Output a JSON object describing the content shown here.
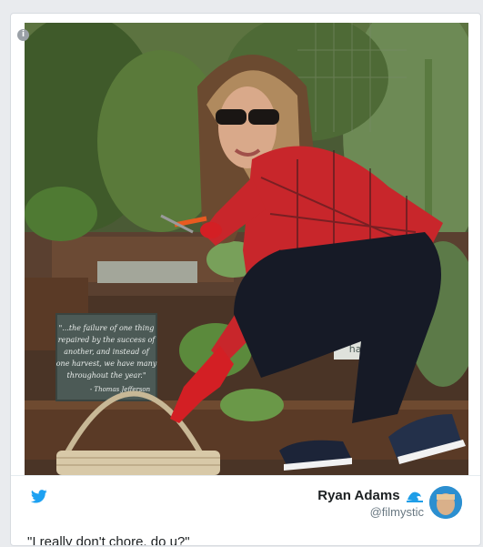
{
  "info": {
    "icon": "info-icon",
    "glyph": "i"
  },
  "photo": {
    "sign_lines": [
      "\"...the failure of one thing",
      "repaired by the success of",
      "another, and instead of",
      "one harvest, we have many",
      "throughout the year.\"",
      "- Thomas Jefferson"
    ],
    "sign2_text": "hake"
  },
  "tweet": {
    "icon": "twitter-bird-icon",
    "author_name": "Ryan Adams",
    "author_emoji": "wave-icon",
    "author_handle": "@filmystic",
    "text": "\"I really don't chore, do u?\"",
    "accent_color": "#1da1f2"
  }
}
